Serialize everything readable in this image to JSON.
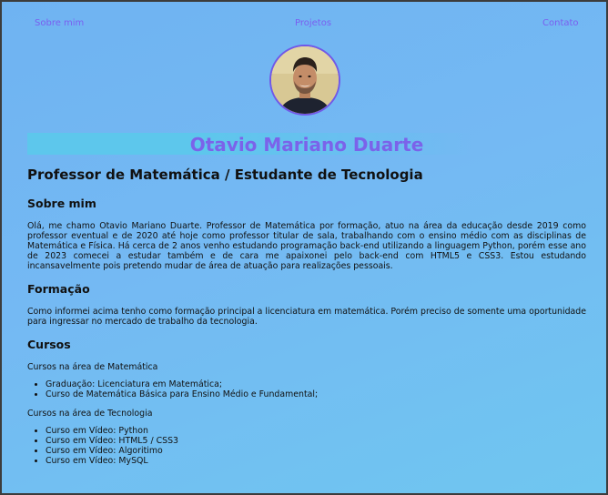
{
  "nav": {
    "items": [
      "Sobre mim",
      "Projetos",
      "Contato"
    ]
  },
  "profile": {
    "name": "Otavio Mariano Duarte",
    "role": "Professor de Matemática / Estudante de Tecnologia"
  },
  "about": {
    "title": "Sobre mim",
    "text": "Olá, me chamo Otavio Mariano Duarte. Professor de Matemática por formação, atuo na área da educação desde 2019 como professor eventual e de 2020 até hoje como professor titular de sala, trabalhando com o ensino médio com as disciplinas de Matemática e Física. Há cerca de 2 anos venho estudando programação back-end utilizando a linguagem Python, porém esse ano de 2023 comecei a estudar também e de cara me apaixonei pelo back-end com HTML5 e CSS3. Estou estudando incansavelmente pois pretendo mudar de área de atuação para realizações pessoais."
  },
  "education": {
    "title": "Formação",
    "text": "Como informei acima tenho como formação principal a licenciatura em matemática. Porém preciso de somente uma oportunidade para ingressar no mercado de trabalho da tecnologia."
  },
  "courses": {
    "title": "Cursos",
    "math_intro": "Cursos na área de Matemática",
    "math_items": [
      "Graduação: Licenciatura em Matemática;",
      "Curso de Matemática Básica para Ensino Médio e Fundamental;"
    ],
    "tech_intro": "Cursos na área de Tecnologia",
    "tech_items": [
      "Curso em Vídeo: Python",
      "Curso em Vídeo: HTML5 / CSS3",
      "Curso em Vídeo: Algoritimo",
      "Curso em Vídeo: MySQL"
    ]
  },
  "colors": {
    "accent": "#7b63ea",
    "background": "#6fb3f2",
    "name_bar": "#5dc7ec"
  }
}
